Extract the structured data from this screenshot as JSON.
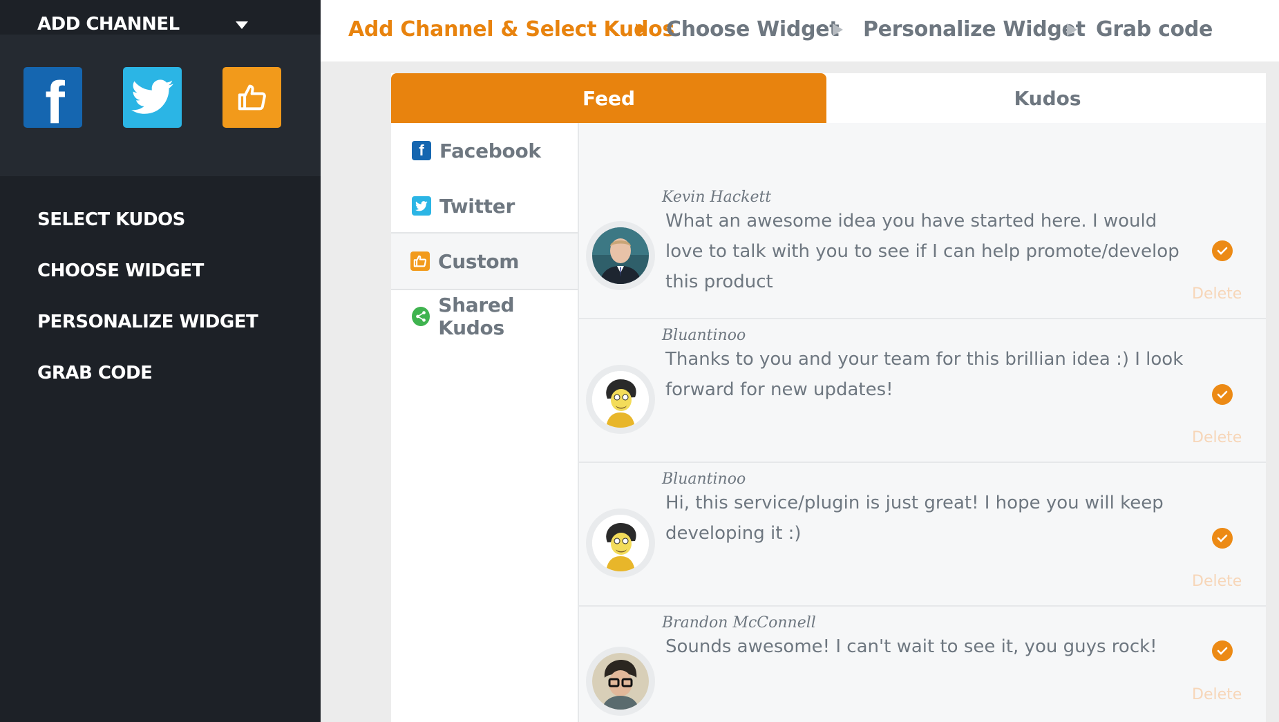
{
  "sidebar": {
    "add_channel_label": "ADD CHANNEL",
    "channels": [
      {
        "name": "facebook",
        "icon": "facebook-icon",
        "color": "#1566b0"
      },
      {
        "name": "twitter",
        "icon": "twitter-bird-icon",
        "color": "#2bb5e5"
      },
      {
        "name": "custom",
        "icon": "thumbs-up-icon",
        "color": "#f29a1b"
      }
    ],
    "nav": [
      {
        "label": "SELECT KUDOS"
      },
      {
        "label": "CHOOSE WIDGET"
      },
      {
        "label": "PERSONALIZE WIDGET"
      },
      {
        "label": "GRAB CODE"
      }
    ]
  },
  "steps": [
    {
      "label": "Add Channel & Select Kudos",
      "active": true
    },
    {
      "label": "Choose Widget",
      "active": false
    },
    {
      "label": "Personalize Widget",
      "active": false
    },
    {
      "label": "Grab code",
      "active": false
    }
  ],
  "tabs": {
    "feed": "Feed",
    "kudos": "Kudos"
  },
  "channel_list": [
    {
      "label": "Facebook",
      "icon": "facebook-icon",
      "color": "#1566b0"
    },
    {
      "label": "Twitter",
      "icon": "twitter-bird-icon",
      "color": "#2bb5e5"
    },
    {
      "label": "Custom",
      "icon": "thumbs-up-icon",
      "color": "#f29a1b",
      "selected": true
    },
    {
      "label": "Shared Kudos",
      "icon": "share-icon",
      "color": "#3fb34f"
    }
  ],
  "posts": [
    {
      "author": "Kevin Hackett",
      "message": "What an awesome idea you have started here. I would love to talk with you to see if I can help promote/develop this product",
      "delete_label": "Delete",
      "avatar": "man-in-suit-avatar"
    },
    {
      "author": "Bluantinoo",
      "message": "Thanks to you and your team for this brillian idea :) I look forward for new updates!",
      "delete_label": "Delete",
      "avatar": "cartoon-character-avatar"
    },
    {
      "author": "Bluantinoo",
      "message": "Hi, this service/plugin is just great! I hope you will keep developing it :)",
      "delete_label": "Delete",
      "avatar": "cartoon-character-avatar"
    },
    {
      "author": "Brandon McConnell",
      "message": "Sounds awesome! I can't wait to see it, you guys rock!",
      "delete_label": "Delete",
      "avatar": "man-with-glasses-avatar"
    }
  ],
  "colors": {
    "accent": "#e8830e",
    "sidebar_bg": "#1d2127",
    "text_gray": "#6e7780"
  }
}
